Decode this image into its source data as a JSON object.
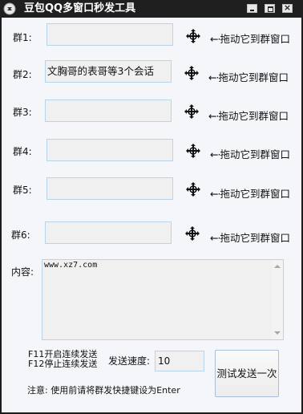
{
  "window": {
    "title": "豆包QQ多窗口秒发工具"
  },
  "groups": [
    {
      "label": "群1:",
      "value": "",
      "hint": "拖动它到群窗口"
    },
    {
      "label": "群2:",
      "value": "文胸哥的表哥等3个会话",
      "hint": "拖动它到群窗口"
    },
    {
      "label": "群3:",
      "value": "",
      "hint": "拖动它到群窗口"
    },
    {
      "label": "群4:",
      "value": "",
      "hint": "拖动它到群窗口"
    },
    {
      "label": "群5:",
      "value": "",
      "hint": "拖动它到群窗口"
    },
    {
      "label": "群6:",
      "value": "",
      "hint": "拖动它到群窗口"
    }
  ],
  "content": {
    "label": "内容:",
    "value": "www.xz7.com"
  },
  "hotkeys": {
    "start": "F11开启连续发送",
    "stop": "F12停止连续发送"
  },
  "speed": {
    "label": "发送速度:",
    "value": "10"
  },
  "send_button": {
    "label": "测试发送一次"
  },
  "note": "注意: 使用前请将群发快捷键设为Enter",
  "icons": {
    "app": "app-icon",
    "drag": "move-crosshair-icon"
  }
}
